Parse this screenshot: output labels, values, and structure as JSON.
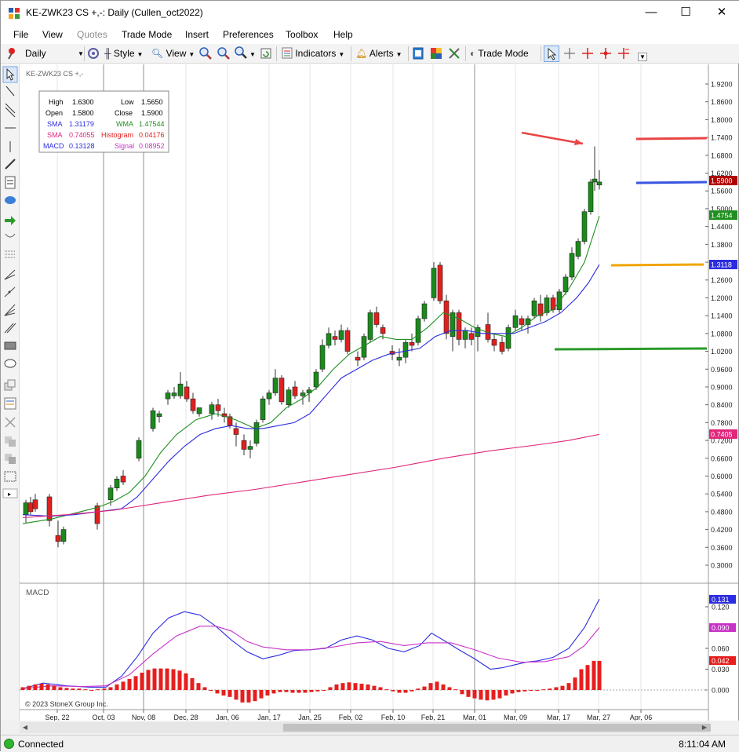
{
  "window": {
    "title": "KE-ZWK23 CS +,-: Daily (Cullen_oct2022)",
    "minimize": "—",
    "maximize": "☐",
    "close": "✕"
  },
  "menu": [
    "File",
    "View",
    "Quotes",
    "Trade Mode",
    "Insert",
    "Preferences",
    "Toolbox",
    "Help"
  ],
  "toolbar": {
    "period": "Daily",
    "style": "Style",
    "view": "View",
    "indicators": "Indicators",
    "alerts": "Alerts",
    "trade_mode": "Trade Mode"
  },
  "chart": {
    "symbol_label": "KE-ZWK23 CS +,-",
    "info_box": {
      "high_label": "High",
      "high": "1.6300",
      "low_label": "Low",
      "low": "1.5650",
      "open_label": "Open",
      "open": "1.5800",
      "close_label": "Close",
      "close": "1.5900",
      "sma1_label": "SMA",
      "sma1": "1.31179",
      "wma_label": "WMA",
      "wma": "1.47544",
      "sma2_label": "SMA",
      "sma2": "0.74055",
      "hist_label": "Histogram",
      "hist": "0.04176",
      "macd_label": "MACD",
      "macd": "0.13128",
      "signal_label": "Signal",
      "signal": "0.08952"
    },
    "price_ticks": [
      "1.9200",
      "1.8600",
      "1.8000",
      "1.7400",
      "1.6800",
      "1.6200",
      "1.5600",
      "1.5000",
      "1.4400",
      "1.3800",
      "1.3200",
      "1.2600",
      "1.2000",
      "1.1400",
      "1.0800",
      "1.0200",
      "0.9600",
      "0.9000",
      "0.8400",
      "0.7800",
      "0.7200",
      "0.6600",
      "0.6000",
      "0.5400",
      "0.4800",
      "0.4200",
      "0.3600",
      "0.3000"
    ],
    "price_tags": {
      "last": "1.5900",
      "wma": "1.4754",
      "sma1": "1.3118",
      "sma2": "0.7405"
    },
    "macd_title": "MACD",
    "macd_ticks": [
      "0.120",
      "0.060",
      "0.030",
      "0.000"
    ],
    "macd_tags": {
      "macd": "0.131",
      "signal": "0.090",
      "hist": "0.042"
    },
    "date_ticks": [
      "Sep, 22",
      "Oct, 03",
      "Nov, 08",
      "Dec, 28",
      "Jan, 06",
      "Jan, 17",
      "Jan, 25",
      "Feb, 02",
      "Feb, 10",
      "Feb, 21",
      "Mar, 01",
      "Mar, 09",
      "Mar, 17",
      "Mar, 27",
      "Apr, 06"
    ],
    "copyright": "© 2023 StoneX Group Inc.",
    "colors": {
      "up": "#1b8a1b",
      "down": "#e0201e",
      "sma1": "#2c2ce0",
      "wma": "#1f8f1f",
      "sma2": "#e0257a",
      "macd": "#2c2ce0",
      "signal": "#c832c8",
      "hist": "#e61e1e"
    }
  },
  "status": {
    "connection": "Connected",
    "time": "8:11:04 AM"
  },
  "icons": [
    "app-icon",
    "pin-icon",
    "settings-icon",
    "magnifier-icon",
    "zoom-in-icon",
    "zoom-out-icon",
    "refresh-icon",
    "indicators-icon",
    "alerts-bell-icon",
    "pointer-icon",
    "crosshair-icon",
    "trendline-icon",
    "text-icon",
    "arrow-icon",
    "rectangle-icon",
    "ellipse-icon",
    "delete-icon"
  ]
}
